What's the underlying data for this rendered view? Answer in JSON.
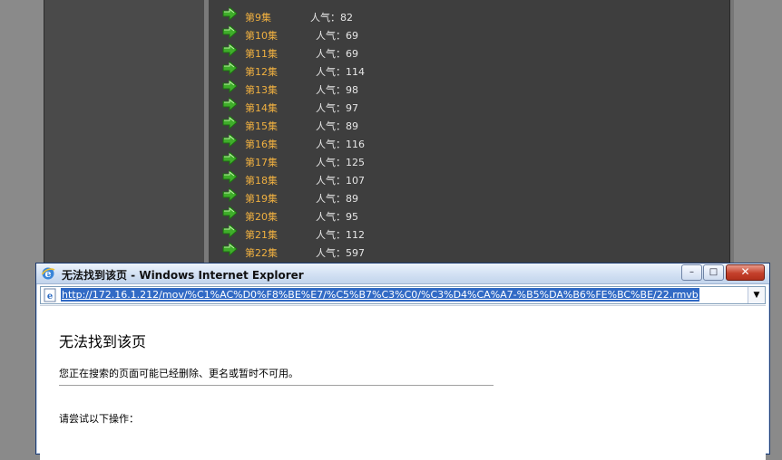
{
  "episodes": [
    {
      "title": "第9集",
      "popularity": "人气：82"
    },
    {
      "title": "第10集",
      "popularity": "人气：69"
    },
    {
      "title": "第11集",
      "popularity": "人气：69"
    },
    {
      "title": "第12集",
      "popularity": "人气：114"
    },
    {
      "title": "第13集",
      "popularity": "人气：98"
    },
    {
      "title": "第14集",
      "popularity": "人气：97"
    },
    {
      "title": "第15集",
      "popularity": "人气：89"
    },
    {
      "title": "第16集",
      "popularity": "人气：116"
    },
    {
      "title": "第17集",
      "popularity": "人气：125"
    },
    {
      "title": "第18集",
      "popularity": "人气：107"
    },
    {
      "title": "第19集",
      "popularity": "人气：89"
    },
    {
      "title": "第20集",
      "popularity": "人气：95"
    },
    {
      "title": "第21集",
      "popularity": "人气：112"
    },
    {
      "title": "第22集",
      "popularity": "人气：597"
    }
  ],
  "ie": {
    "title": "无法找到该页 - Windows Internet Explorer",
    "url": "http://172.16.1.212/mov/%C1%AC%D0%F8%BE%E7/%C5%B7%C3%C0/%C3%D4%CA%A7-%B5%DA%B6%FE%BC%BE/22.rmvb",
    "minimize": "–",
    "restore": "□",
    "close": "✕",
    "dropdown": "▼"
  },
  "error_page": {
    "heading": "无法找到该页",
    "description": "您正在搜索的页面可能已经删除、更名或暂时不可用。",
    "try_heading": "请尝试以下操作："
  },
  "colors": {
    "episode_title": "#f0b040",
    "popularity": "#e6e6e6",
    "panel_bg": "#3e3e3e",
    "url_highlight": "#316ac5"
  },
  "icons": {
    "episode": "green-arrow-icon",
    "browser": "ie-logo-icon",
    "page": "page-icon"
  }
}
